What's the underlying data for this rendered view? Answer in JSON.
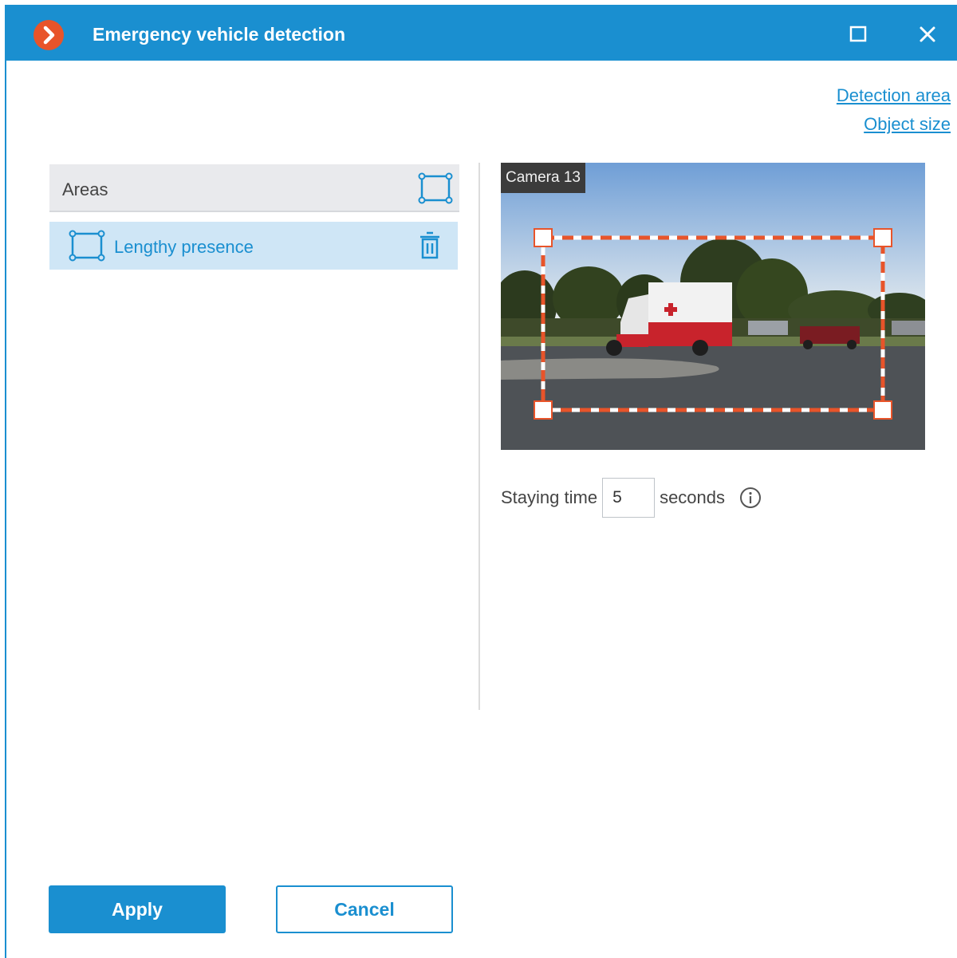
{
  "window": {
    "title": "Emergency vehicle detection",
    "accent_color": "#1a8fd0",
    "logo_color": "#e8542a"
  },
  "links": {
    "detection_area": "Detection area",
    "object_size": "Object size"
  },
  "areas": {
    "header": "Areas",
    "items": [
      {
        "label": "Lengthy presence"
      }
    ]
  },
  "camera": {
    "label": "Camera 13"
  },
  "staying": {
    "label": "Staying time",
    "value": "5",
    "unit": "seconds"
  },
  "buttons": {
    "apply": "Apply",
    "cancel": "Cancel"
  },
  "icons": [
    "app-logo-icon",
    "maximize-icon",
    "close-icon",
    "add-area-icon",
    "area-shape-icon",
    "trash-icon",
    "info-icon"
  ]
}
